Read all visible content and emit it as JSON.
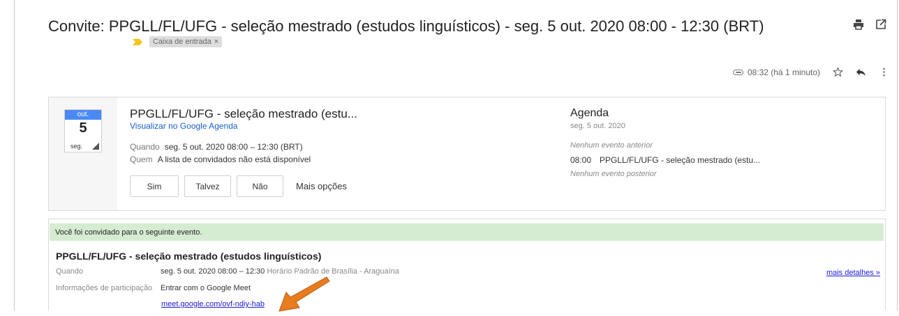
{
  "email": {
    "subject": "Convite: PPGLL/FL/UFG - seleção mestrado (estudos linguísticos) - seg. 5 out. 2020 08:00 - 12:30 (BRT)",
    "label": "Caixa de entrada",
    "label_close": "×",
    "time": "08:32 (há 1 minuto)"
  },
  "icons": {
    "print": "print-icon",
    "open_new": "open-in-new-window-icon",
    "attachment": "attachment-icon",
    "star": "star-icon",
    "reply": "reply-icon",
    "more": "more-vert-icon",
    "important": "important-marker-icon"
  },
  "calendar": {
    "month": "out.",
    "day": "5",
    "weekday": "seg."
  },
  "event": {
    "title": "PPGLL/FL/UFG - seleção mestrado (estu...",
    "view_link": "Visualizar no Google Agenda",
    "when_label": "Quando",
    "when_value": "seg. 5 out. 2020 08:00 – 12:30 (BRT)",
    "who_label": "Quem",
    "who_value": "A lista de convidados não está disponível",
    "rsvp": {
      "yes": "Sim",
      "maybe": "Talvez",
      "no": "Não",
      "more": "Mais opções"
    }
  },
  "agenda": {
    "title": "Agenda",
    "date": "seg. 5 out. 2020",
    "no_previous": "Nenhum evento anterior",
    "event_time": "08:00",
    "event_title": "PPGLL/FL/UFG - seleção mestrado (estu...",
    "no_next": "Nenhum evento posterior"
  },
  "invite_details": {
    "banner": "Você foi convidado para o seguinte evento.",
    "title": "PPGLL/FL/UFG - seleção mestrado (estudos linguísticos)",
    "when_label": "Quando",
    "when_value": "seg. 5 out. 2020 08:00 – 12:30",
    "timezone": "Horário Padrão de Brasília - Araguaína",
    "more_details": "mais detalhes »",
    "join_label": "Informações de participação",
    "join_value": "Entrar com o Google Meet",
    "meet_link": "meet.google.com/ovf-ndiy-hab"
  },
  "colors": {
    "accent_blue": "#4a8af4",
    "link_blue": "#1a5fd0",
    "banner_green": "#d6ecd2",
    "important_yellow": "#f5c518",
    "annotation_orange": "#e87c1e"
  }
}
